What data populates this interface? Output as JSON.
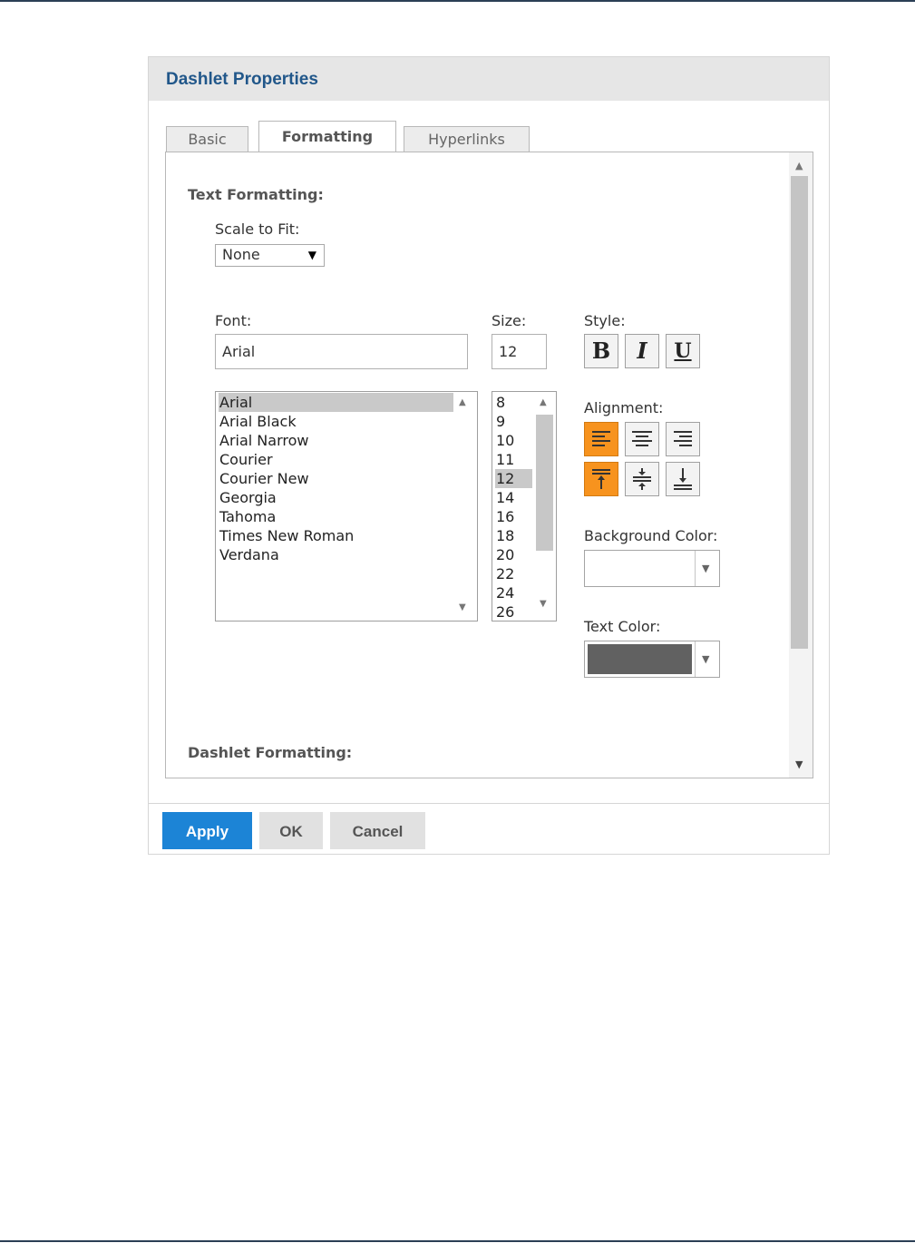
{
  "dialog": {
    "title": "Dashlet Properties",
    "tabs": [
      {
        "label": "Basic",
        "active": false
      },
      {
        "label": "Formatting",
        "active": true
      },
      {
        "label": "Hyperlinks",
        "active": false
      }
    ]
  },
  "formatting": {
    "text_formatting_title": "Text Formatting:",
    "scale_to_fit_label": "Scale to Fit:",
    "scale_to_fit_value": "None",
    "font_label": "Font:",
    "font_value": "Arial",
    "size_label": "Size:",
    "size_value": "12",
    "style_label": "Style:",
    "style_buttons": {
      "bold": "B",
      "italic": "I",
      "underline": "U"
    },
    "font_list": [
      "Arial",
      "Arial Black",
      "Arial Narrow",
      "Courier",
      "Courier New",
      "Georgia",
      "Tahoma",
      "Times New Roman",
      "Verdana"
    ],
    "font_selected": "Arial",
    "size_list": [
      "8",
      "9",
      "10",
      "11",
      "12",
      "14",
      "16",
      "18",
      "20",
      "22",
      "24",
      "26"
    ],
    "size_selected": "12",
    "alignment_label": "Alignment:",
    "horizontal_alignment": [
      "align-left-icon",
      "align-center-icon",
      "align-right-icon"
    ],
    "horizontal_alignment_selected": "align-left-icon",
    "vertical_alignment": [
      "align-top-icon",
      "align-middle-icon",
      "align-bottom-icon"
    ],
    "vertical_alignment_selected": "align-top-icon",
    "background_color_label": "Background Color:",
    "background_color_value": "#ffffff",
    "text_color_label": "Text Color:",
    "text_color_value": "#616161",
    "dashlet_formatting_title": "Dashlet Formatting:"
  },
  "footer": {
    "apply_label": "Apply",
    "ok_label": "OK",
    "cancel_label": "Cancel"
  },
  "colors": {
    "accent_orange": "#f7931e",
    "primary_blue": "#1c84d6",
    "title_blue": "#21578a"
  }
}
